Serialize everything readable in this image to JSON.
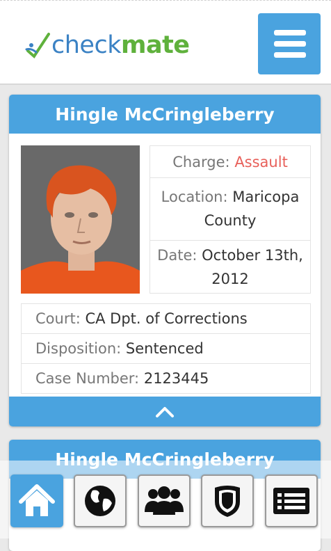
{
  "brand": {
    "check": "check",
    "mate": "mate"
  },
  "colors": {
    "accent": "#4aa3df",
    "danger": "#e8605a",
    "logo_blue": "#3b82c4",
    "logo_green": "#5fb13c"
  },
  "header": {
    "menu_icon": "hamburger-icon"
  },
  "records": [
    {
      "name": "Hingle McCringleberry",
      "charge_label": "Charge:",
      "charge_value": "Assault",
      "location_label": "Location:",
      "location_value": "Maricopa County",
      "date_label": "Date:",
      "date_value": "October 13th, 2012",
      "court_label": "Court:",
      "court_value": "CA Dpt. of Corrections",
      "disposition_label": "Disposition:",
      "disposition_value": "Sentenced",
      "case_label": "Case Number:",
      "case_value": "2123445",
      "collapse_icon": "chevron-up-icon"
    },
    {
      "name": "Hingle McCringleberry"
    }
  ],
  "dock": [
    {
      "icon": "home-icon",
      "active": true
    },
    {
      "icon": "globe-icon",
      "active": false
    },
    {
      "icon": "users-icon",
      "active": false
    },
    {
      "icon": "police-badge-icon",
      "active": false
    },
    {
      "icon": "list-icon",
      "active": false
    }
  ]
}
